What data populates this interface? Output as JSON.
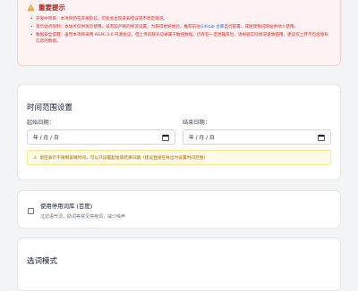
{
  "notice": {
    "icon": "warning-icon",
    "title": "重要提示",
    "items": [
      {
        "text": "开发中项目：本项目仍在开发阶段，可能会出现未知错误或不稳定情况。"
      },
      {
        "text_before": "演示站点限制：本站点仅供演示使用，设有较严格的频流设置。为获得更好体验，推荐前往",
        "link": "GitHub 仓库",
        "text_after": "自行部署，或继建我问网站供他人使用。"
      },
      {
        "text": "数据安全提醒：虽然本项目采用 AGPL-3.0 开源协议，但上传的聊天记录属于敏感数据。仍存在一定泄露风险，请根据实际情况谨慎使用，建议仅上传不包含隐私信息的数据。"
      }
    ]
  },
  "time_range": {
    "title": "时间范围设置",
    "start_label": "起始日期：",
    "end_label": "结束日期：",
    "date_placeholder": "年 / 月 / 日",
    "calendar_icon": "calendar-icon",
    "hint": "留空表示不限制该端时间，可以只设置起始或结束日期（建议直接在导出时设置时间范围）"
  },
  "stopwords": {
    "checkbox_label": "使用停用词库 (百度)",
    "description": "过滤语气词、助词等常见停用词，减少噪声",
    "checked": false
  },
  "segmentation": {
    "title": "选词模式"
  },
  "colors": {
    "notice_text": "#dc2626",
    "link": "#2563eb",
    "hint_text": "#a16207"
  }
}
